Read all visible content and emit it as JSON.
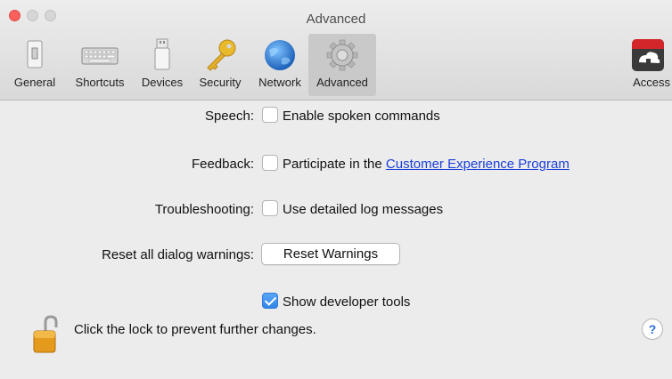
{
  "window": {
    "title": "Advanced"
  },
  "toolbar": {
    "tabs": [
      {
        "label": "General",
        "icon": "general-switch-icon"
      },
      {
        "label": "Shortcuts",
        "icon": "keyboard-icon"
      },
      {
        "label": "Devices",
        "icon": "usb-device-icon"
      },
      {
        "label": "Security",
        "icon": "key-icon"
      },
      {
        "label": "Network",
        "icon": "globe-icon"
      },
      {
        "label": "Advanced",
        "icon": "gear-icon",
        "selected": true
      },
      {
        "label": "Access",
        "icon": "parallels-access-icon",
        "badge": "||Parallels"
      }
    ]
  },
  "settings": {
    "speech": {
      "label": "Speech:",
      "checkbox_text": "Enable spoken commands",
      "checked": false
    },
    "feedback": {
      "label": "Feedback:",
      "checkbox_text_prefix": "Participate in the ",
      "link_text": "Customer Experience Program",
      "checked": false
    },
    "troubleshooting": {
      "label": "Troubleshooting:",
      "checkbox_text": "Use detailed log messages",
      "checked": false
    },
    "reset": {
      "label": "Reset all dialog warnings:",
      "button_label": "Reset Warnings"
    },
    "developer": {
      "checkbox_text": "Show developer tools",
      "checked": true
    }
  },
  "footer": {
    "lock_text": "Click the lock to prevent further changes.",
    "help_label": "?"
  },
  "colors": {
    "accent": "#2f85e8",
    "link": "#1a3fd8",
    "close": "#fc605c"
  }
}
